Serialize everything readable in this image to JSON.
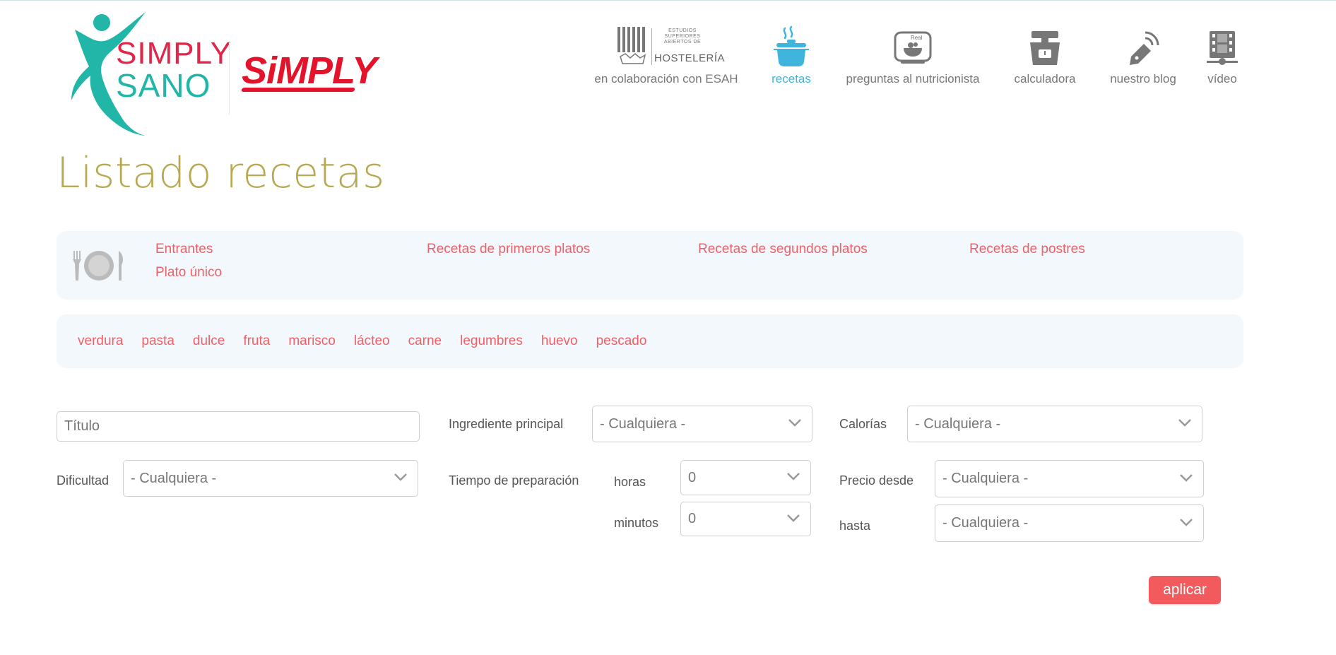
{
  "logo": {
    "line1": "SIMPLY",
    "line2": "SANO",
    "brand": "SiMPLY"
  },
  "nav": {
    "items": [
      {
        "label": "en colaboración con ESAH",
        "icon": "esah-logo-icon",
        "esah_small": "ESTUDIOS SUPERIORES ABIERTOS DE",
        "esah_big": "HOSTELERÍA"
      },
      {
        "label": "recetas",
        "icon": "cooking-pot-icon",
        "active": true
      },
      {
        "label": "preguntas al nutricionista",
        "icon": "nutritionist-icon"
      },
      {
        "label": "calculadora",
        "icon": "scale-icon"
      },
      {
        "label": "nuestro blog",
        "icon": "pen-nib-icon"
      },
      {
        "label": "vídeo",
        "icon": "film-icon"
      }
    ]
  },
  "page": {
    "title": "Listado recetas"
  },
  "categories": {
    "icon": "plate-cutlery-icon",
    "items": [
      "Entrantes",
      "Plato único",
      "Recetas de primeros platos",
      "Recetas de segundos platos",
      "Recetas de postres"
    ]
  },
  "ingredients": [
    "verdura",
    "pasta",
    "dulce",
    "fruta",
    "marisco",
    "lácteo",
    "carne",
    "legumbres",
    "huevo",
    "pescado"
  ],
  "form": {
    "title_placeholder": "Título",
    "ingredient_label": "Ingrediente principal",
    "ingredient_value": "- Cualquiera -",
    "calories_label": "Calorías",
    "calories_value": "- Cualquiera -",
    "difficulty_label": "Dificultad",
    "difficulty_value": "- Cualquiera -",
    "prep_time_label": "Tiempo de preparación",
    "hours_label": "horas",
    "hours_value": "0",
    "minutes_label": "minutos",
    "minutes_value": "0",
    "price_from_label": "Precio desde",
    "price_from_value": "- Cualquiera -",
    "price_to_label": "hasta",
    "price_to_value": "- Cualquiera -",
    "apply_label": "aplicar"
  },
  "colors": {
    "accent_link": "#f06067",
    "title": "#b8a851",
    "active_nav": "#3fb4dd",
    "apply_button": "#f25a5d",
    "panel_bg": "#f3f8fc"
  }
}
